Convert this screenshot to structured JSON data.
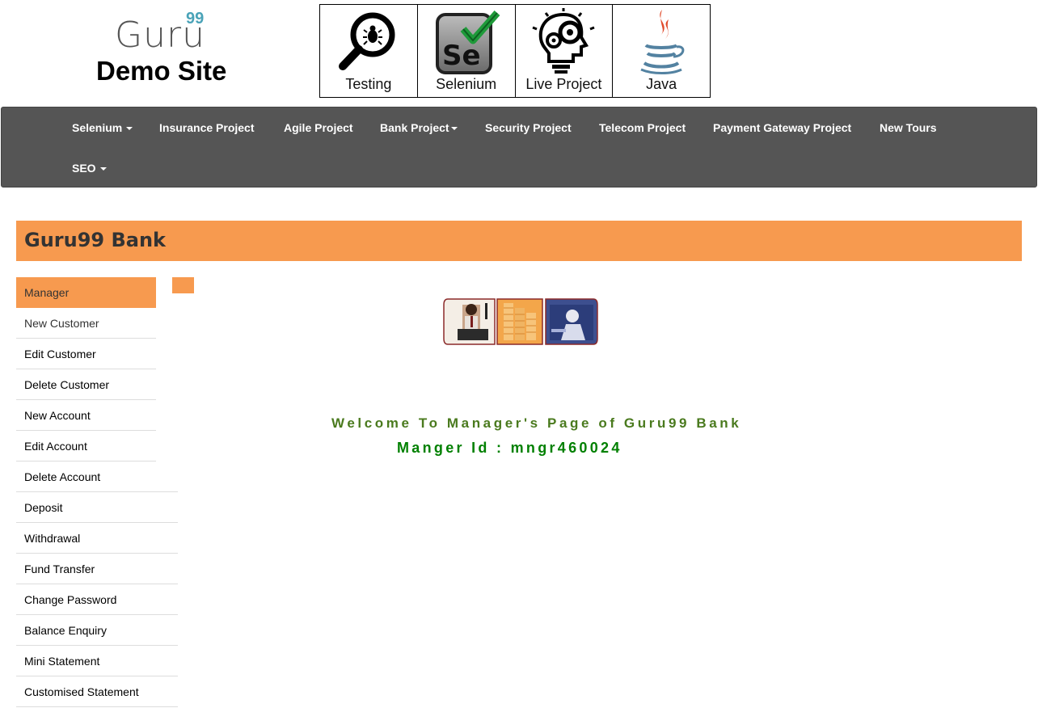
{
  "header": {
    "logo": {
      "brand": "Guru",
      "superscript": "99",
      "subtitle": "Demo Site"
    },
    "tiles": [
      {
        "label": "Testing",
        "icon": "magnifier-bug-icon"
      },
      {
        "label": "Selenium",
        "icon": "selenium-icon"
      },
      {
        "label": "Live Project",
        "icon": "lightbulb-gears-icon"
      },
      {
        "label": "Java",
        "icon": "java-cup-icon"
      }
    ]
  },
  "navbar": {
    "items": [
      {
        "label": "Selenium",
        "dropdown": true
      },
      {
        "label": "Insurance Project",
        "dropdown": false
      },
      {
        "label": "Agile Project",
        "dropdown": false
      },
      {
        "label": "Bank Project",
        "dropdown": true
      },
      {
        "label": "Security Project",
        "dropdown": false
      },
      {
        "label": "Telecom Project",
        "dropdown": false
      },
      {
        "label": "Payment Gateway Project",
        "dropdown": false
      },
      {
        "label": "New Tours",
        "dropdown": false
      },
      {
        "label": "SEO",
        "dropdown": true
      }
    ]
  },
  "bank": {
    "title": "Guru99 Bank"
  },
  "menu": {
    "items": [
      "Manager",
      "New Customer",
      "Edit Customer",
      "Delete Customer",
      "New Account",
      "Edit Account",
      "Delete Account",
      "Deposit",
      "Withdrawal",
      "Fund Transfer",
      "Change Password",
      "Balance Enquiry",
      "Mini Statement",
      "Customised Statement"
    ],
    "active": "Manager"
  },
  "main": {
    "welcome": "Welcome To Manager's Page of Guru99 Bank",
    "manager_id": "Manger Id : mngr460024"
  },
  "colors": {
    "accent": "#f79a4f",
    "navbar_bg": "#555555",
    "welcome_text": "#4a7a1e",
    "manager_id_text": "#008000"
  }
}
